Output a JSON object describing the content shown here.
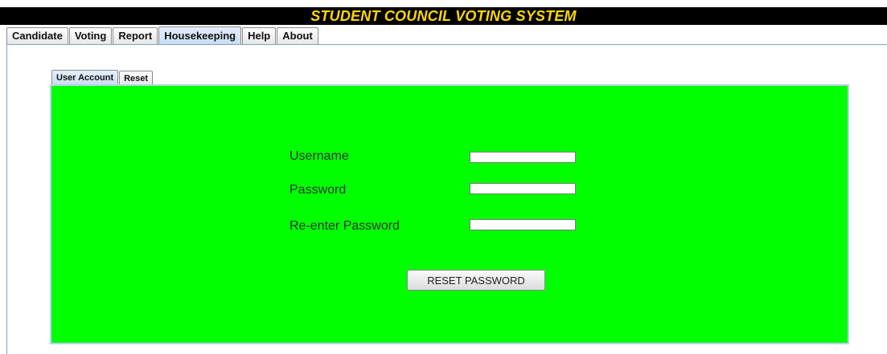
{
  "window": {
    "title": "STUDENT COUNCIL VOTING SYSTEM"
  },
  "colors": {
    "title_text": "#ffd700",
    "title_bar": "#000000",
    "panel_background": "#00ff00"
  },
  "main_tabs": [
    {
      "label": "Candidate",
      "active": false
    },
    {
      "label": "Voting",
      "active": false
    },
    {
      "label": "Report",
      "active": false
    },
    {
      "label": "Housekeeping",
      "active": true
    },
    {
      "label": "Help",
      "active": false
    },
    {
      "label": "About",
      "active": false
    }
  ],
  "sub_tabs": [
    {
      "label": "User Account",
      "active": true
    },
    {
      "label": "Reset",
      "active": false
    }
  ],
  "form": {
    "username_label": "Username",
    "username_value": "",
    "password_label": "Password",
    "password_value": "",
    "reenter_label": "Re-enter Password",
    "reenter_value": "",
    "submit_label": "RESET PASSWORD"
  }
}
